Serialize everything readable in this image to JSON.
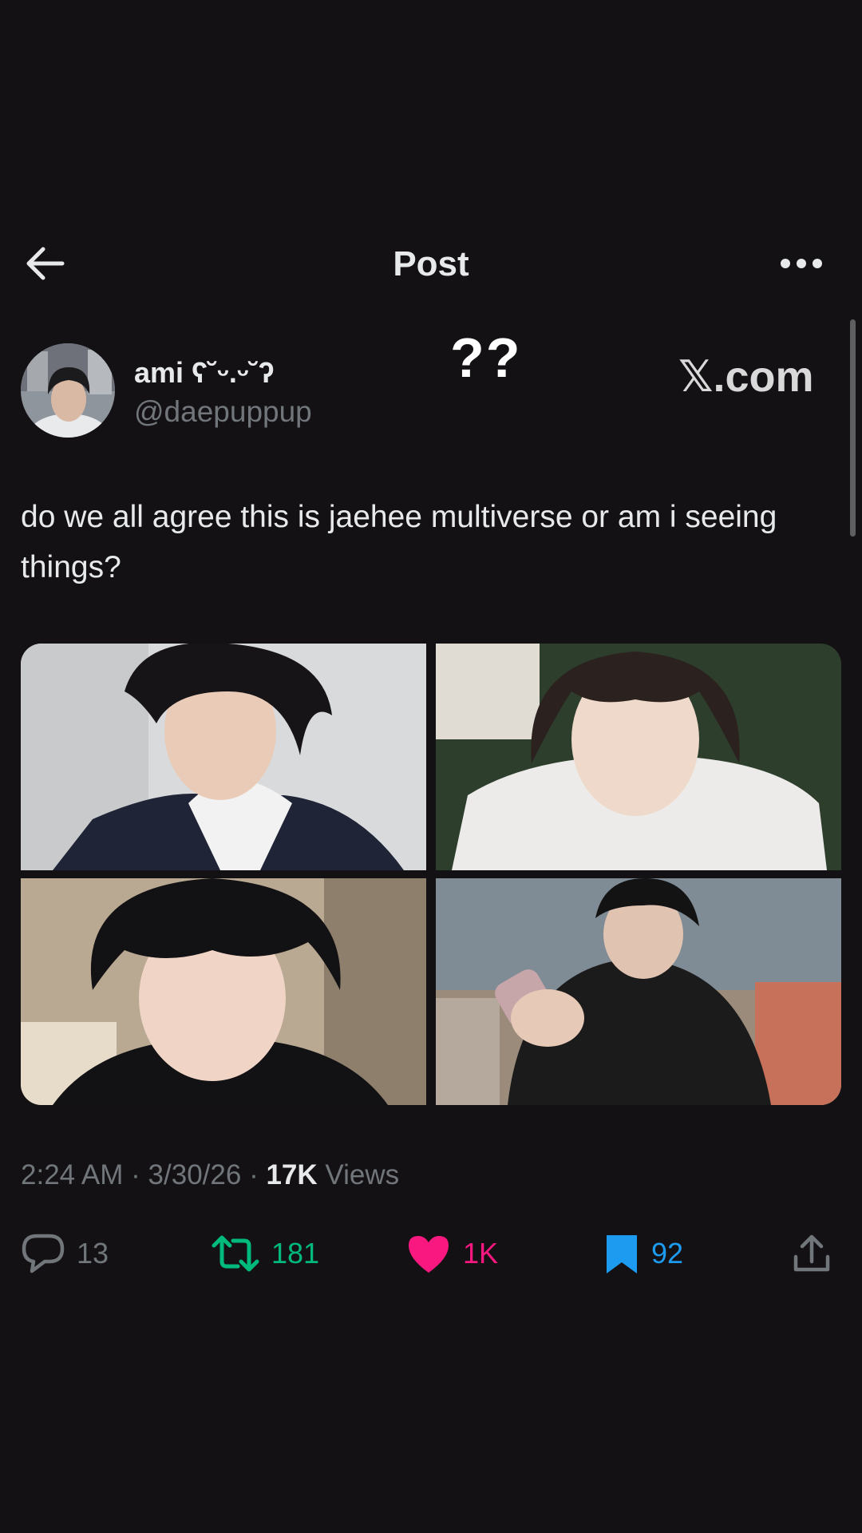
{
  "header": {
    "title": "Post"
  },
  "overlay": {
    "question_marks": "??",
    "watermark": "𝕏.com"
  },
  "author": {
    "display_name": "ami ʕ˘ᵕ.ᵕ˘ʔ",
    "handle": "@daepuppup"
  },
  "tweet": {
    "text": "do we all agree this is jaehee multiverse or am i seeing things?",
    "time": "2:24 AM",
    "date": "3/30/26",
    "views_count": "17K",
    "views_label": "Views",
    "separator": "·"
  },
  "stats": {
    "replies": "13",
    "reposts": "181",
    "likes": "1K",
    "bookmarks": "92"
  },
  "colors": {
    "background": "#141115",
    "text_primary": "#e7e9ea",
    "text_secondary": "#71767b",
    "repost_active": "#00ba7c",
    "like_active": "#f91880",
    "bookmark_active": "#1d9bf0"
  },
  "icons": {
    "back": "arrow-left-icon",
    "more": "more-dots-icon",
    "reply": "reply-bubble-icon",
    "repost": "repost-icon",
    "like": "heart-icon",
    "bookmark": "bookmark-icon",
    "share": "share-upload-icon"
  }
}
